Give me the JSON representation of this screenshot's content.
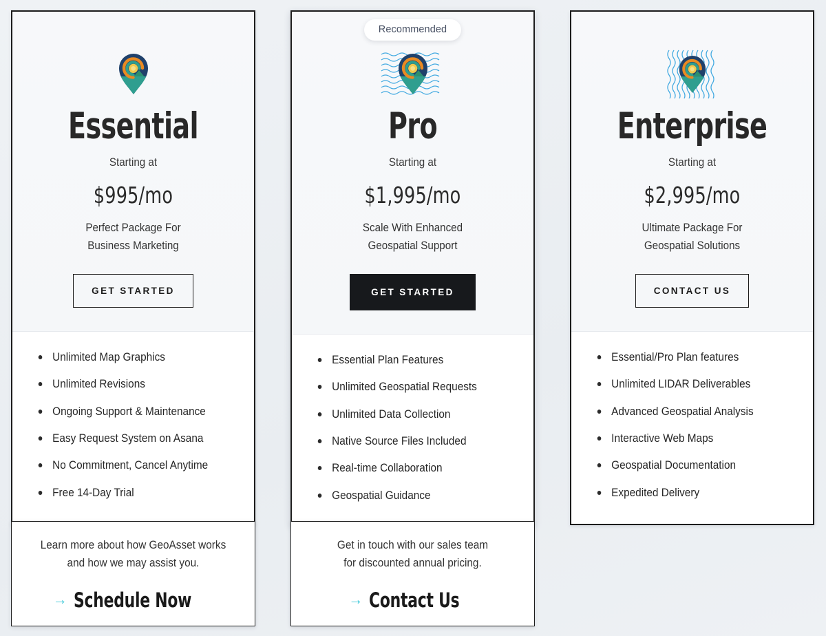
{
  "theme": {
    "page_background": "#eef1f4",
    "card_border": "#1c1c1c",
    "card_header_bg": "#f6f8fa",
    "card_body_bg": "#ffffff",
    "text_primary": "#282828",
    "solid_button_bg": "#17191c",
    "solid_button_text": "#ffffff",
    "arrow_accent": "#3ec8d8",
    "badge_text": "#475063",
    "logo_pin_navy": "#20416b",
    "logo_pin_teal": "#2f9e8f",
    "logo_pin_green": "#2d8f6f",
    "logo_ring_orange": "#e98a22",
    "logo_ring_yellow": "#f2c94c",
    "logo_wave_blue": "#3aa6e0"
  },
  "plans": [
    {
      "id": "essential",
      "name": "Essential",
      "badge": null,
      "logo_icon": "geoasset-pin-icon",
      "logo_waves": "none",
      "starting_at_label": "Starting at",
      "price": "$995/mo",
      "tagline_line1": "Perfect Package For",
      "tagline_line2": "Business Marketing",
      "cta_label": "GET STARTED",
      "cta_style": "outline",
      "features": [
        "Unlimited Map Graphics",
        "Unlimited Revisions",
        "Ongoing Support & Maintenance",
        "Easy Request System on Asana",
        "No Commitment, Cancel Anytime",
        "Free 14-Day Trial"
      ]
    },
    {
      "id": "pro",
      "name": "Pro",
      "badge": "Recommended",
      "logo_icon": "geoasset-pin-icon",
      "logo_waves": "horizontal",
      "starting_at_label": "Starting at",
      "price": "$1,995/mo",
      "tagline_line1": "Scale With Enhanced",
      "tagline_line2": "Geospatial Support",
      "cta_label": "GET STARTED",
      "cta_style": "solid",
      "features": [
        "Essential Plan Features",
        "Unlimited Geospatial Requests",
        "Unlimited Data Collection",
        "Native Source Files Included",
        "Real-time Collaboration",
        "Geospatial Guidance"
      ]
    },
    {
      "id": "enterprise",
      "name": "Enterprise",
      "badge": null,
      "logo_icon": "geoasset-pin-icon",
      "logo_waves": "vertical",
      "starting_at_label": "Starting at",
      "price": "$2,995/mo",
      "tagline_line1": "Ultimate Package For",
      "tagline_line2": "Geospatial Solutions",
      "cta_label": "CONTACT US",
      "cta_style": "outline",
      "features": [
        "Essential/Pro Plan features",
        "Unlimited LIDAR Deliverables",
        "Advanced Geospatial Analysis",
        "Interactive Web Maps",
        "Geospatial Documentation",
        "Expedited Delivery"
      ]
    }
  ],
  "cta_cards": [
    {
      "id": "schedule",
      "copy_line1": "Learn more about how GeoAsset works",
      "copy_line2": "and how we may assist you.",
      "arrow_icon": "arrow-right-icon",
      "link_label": "Schedule Now"
    },
    {
      "id": "contact",
      "copy_line1": "Get in touch with our sales team",
      "copy_line2": "for discounted annual pricing.",
      "arrow_icon": "arrow-right-icon",
      "link_label": "Contact Us"
    }
  ]
}
